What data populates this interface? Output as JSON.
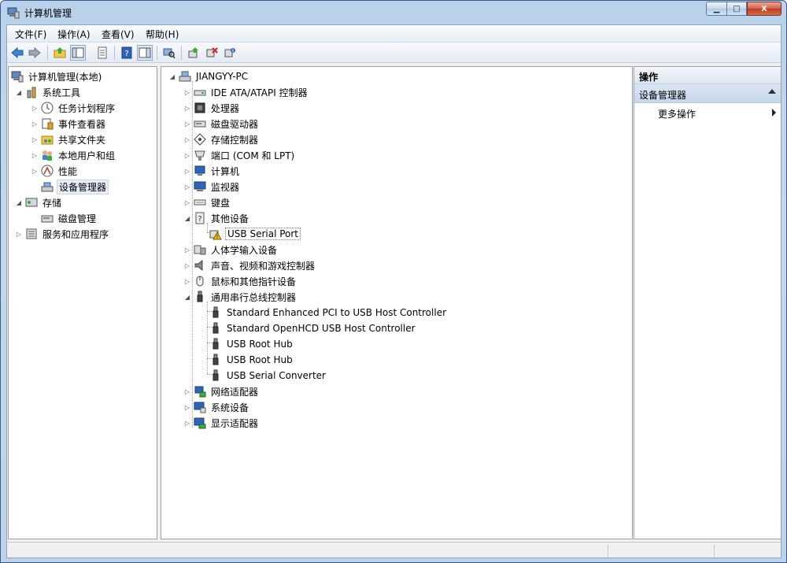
{
  "window": {
    "title": "计算机管理"
  },
  "caption_buttons": {
    "minimize": "▁",
    "maximize": "□",
    "close": "X"
  },
  "menu": [
    "文件(F)",
    "操作(A)",
    "查看(V)",
    "帮助(H)"
  ],
  "toolbar": [
    "back-icon",
    "forward-icon",
    "up-folder-icon",
    "show-tree-icon",
    "export-list-icon",
    "help-icon",
    "show-action-pane-icon",
    "scan-hardware-icon",
    "update-driver-icon",
    "uninstall-icon",
    "disable-icon"
  ],
  "left_tree": {
    "root": "计算机管理(本地)",
    "system_tools": "系统工具",
    "task_scheduler": "任务计划程序",
    "event_viewer": "事件查看器",
    "shared_folders": "共享文件夹",
    "local_users": "本地用户和组",
    "performance": "性能",
    "device_manager": "设备管理器",
    "storage": "存储",
    "disk_management": "磁盘管理",
    "services": "服务和应用程序"
  },
  "device_tree": {
    "root": "JIANGYY-PC",
    "categories": [
      "IDE ATA/ATAPI 控制器",
      "处理器",
      "磁盘驱动器",
      "存储控制器",
      "端口 (COM 和 LPT)",
      "计算机",
      "监视器",
      "键盘",
      "其他设备",
      "人体学输入设备",
      "声音、视频和游戏控制器",
      "鼠标和其他指针设备",
      "通用串行总线控制器",
      "网络适配器",
      "系统设备",
      "显示适配器"
    ],
    "other_devices": [
      "USB Serial Port"
    ],
    "usb_controllers": [
      "Standard Enhanced PCI to USB Host Controller",
      "Standard OpenHCD USB Host Controller",
      "USB Root Hub",
      "USB Root Hub",
      "USB Serial Converter"
    ]
  },
  "actions": {
    "header": "操作",
    "group": "设备管理器",
    "more": "更多操作"
  },
  "colors": {
    "accent": "#3b5d85",
    "selection": "#e8eef6"
  }
}
